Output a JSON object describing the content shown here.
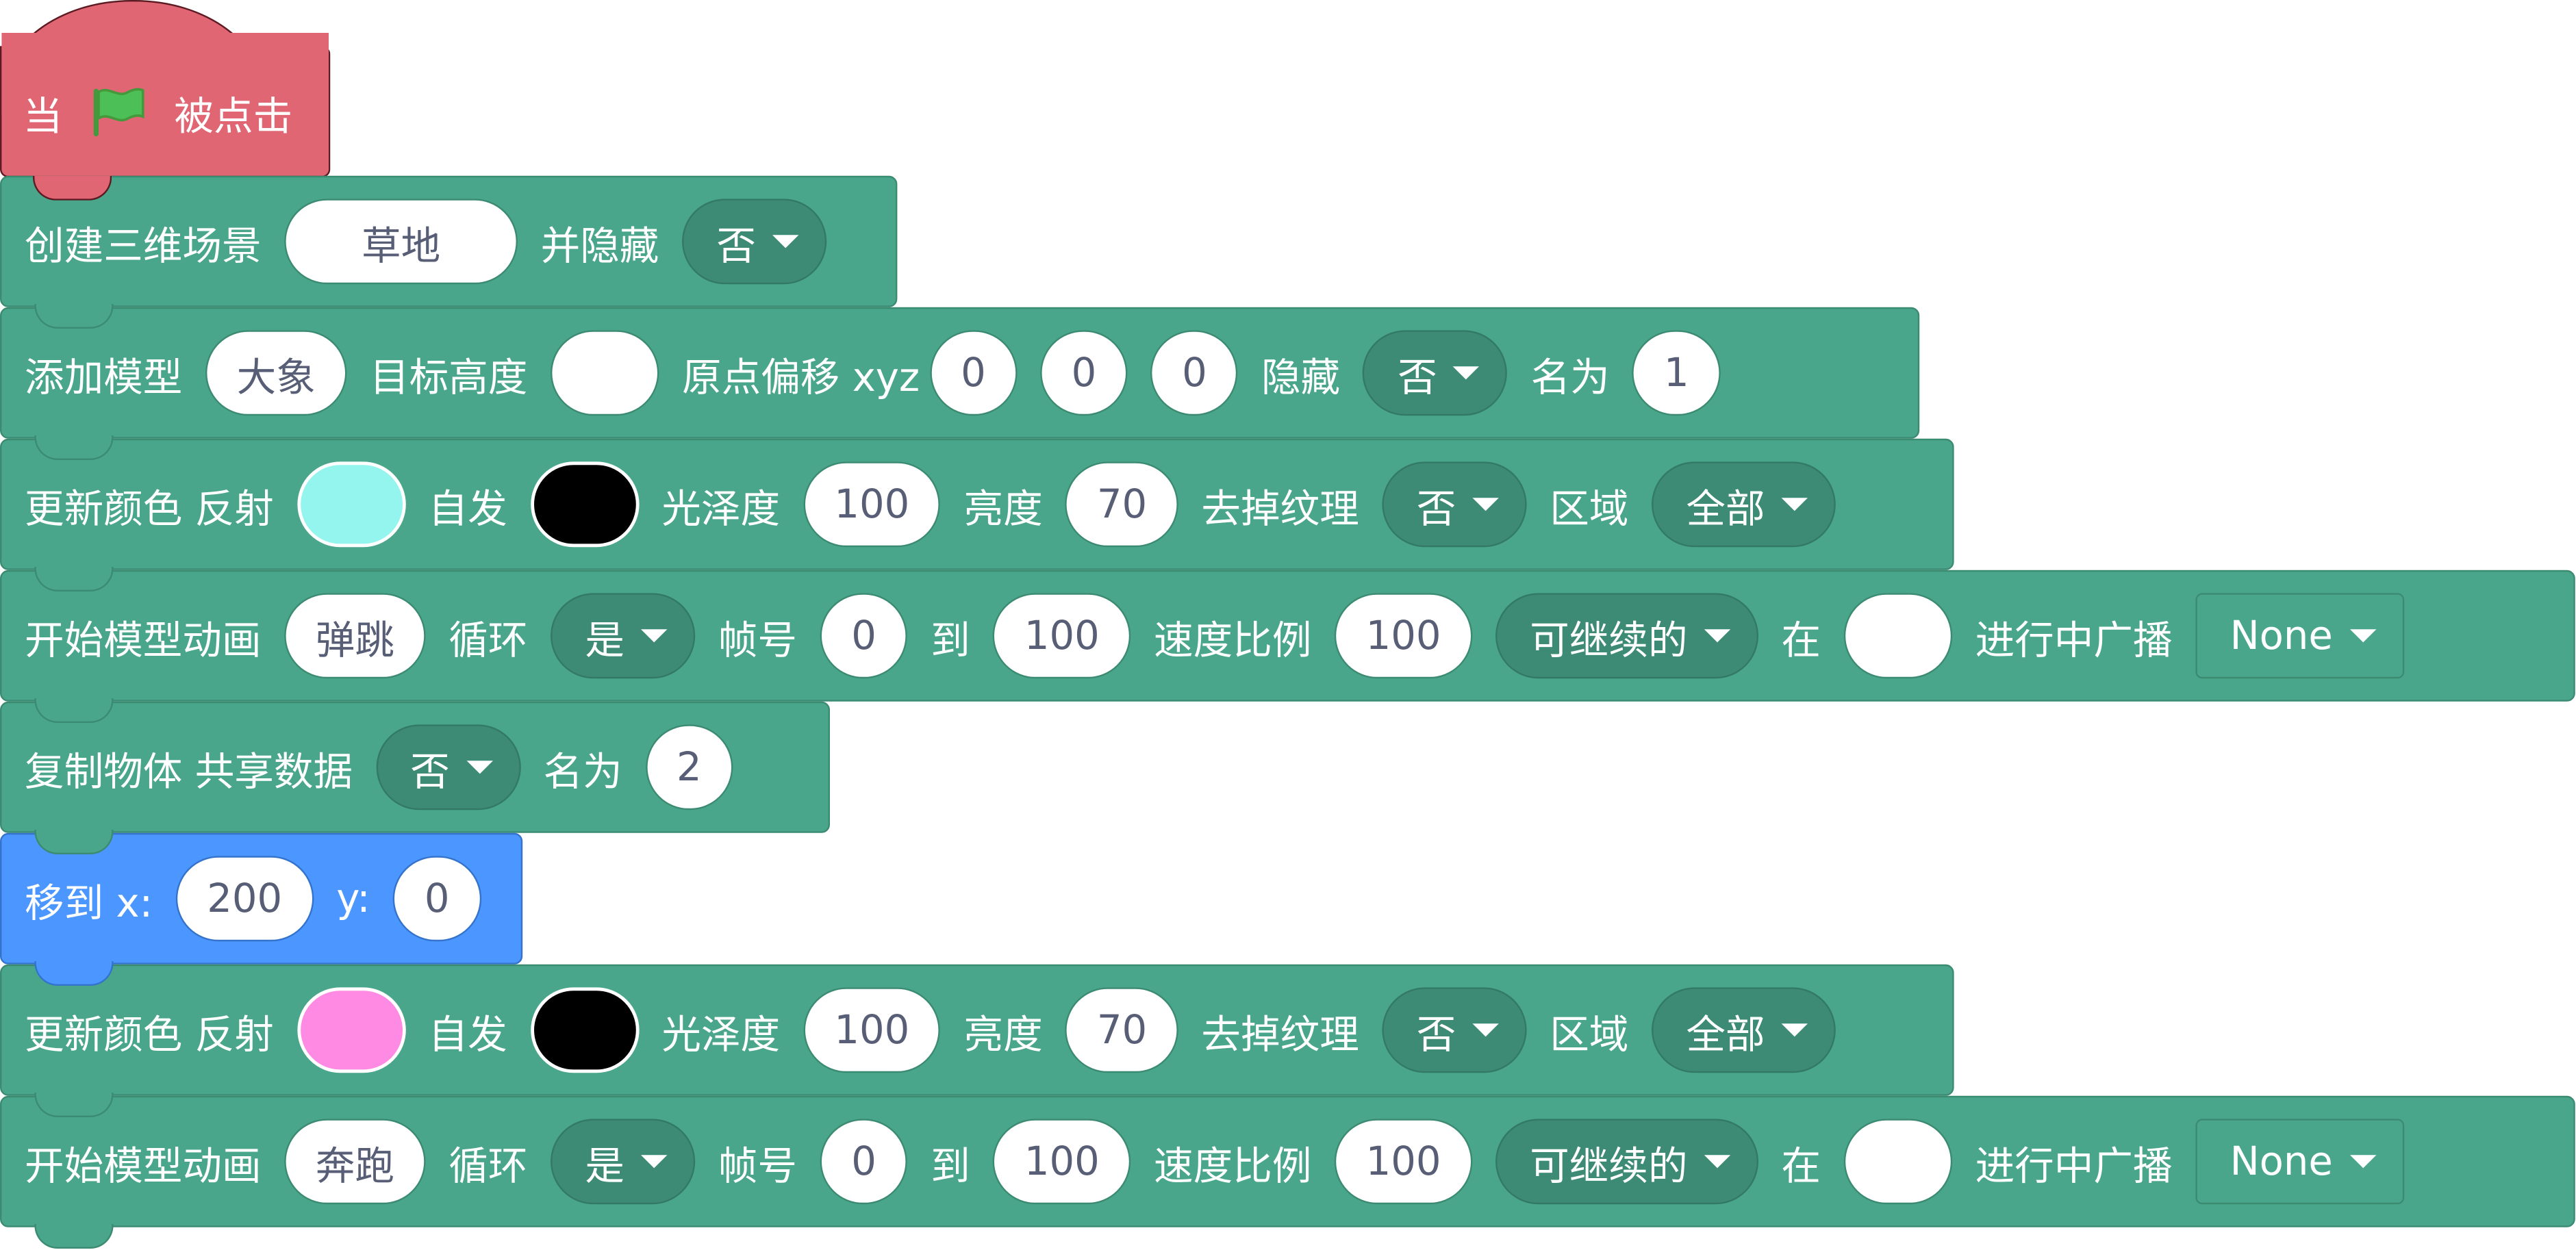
{
  "colors": {
    "motion": "#4c97ff",
    "extension": "#4aa68b",
    "events": "#e06673",
    "color_cyan": "#93f5ed",
    "color_black": "#000000",
    "color_pink": "#ff8ae4"
  },
  "hat": {
    "prefix": "当",
    "icon": "green-flag-icon",
    "suffix": "被点击"
  },
  "b1": {
    "label": "创建三维场景",
    "scene": "草地",
    "hide_label": "并隐藏",
    "hide": "否"
  },
  "b2": {
    "label": "添加模型",
    "model": "大象",
    "height_label": "目标高度",
    "height": "",
    "offset_label": "原点偏移 xyz",
    "x": "0",
    "y": "0",
    "z": "0",
    "hide_label": "隐藏",
    "hide": "否",
    "name_label": "名为",
    "name": "1"
  },
  "b3": {
    "label": "更新颜色 反射",
    "emit_label": "自发",
    "gloss_label": "光泽度",
    "gloss": "100",
    "bright_label": "亮度",
    "bright": "70",
    "texture_label": "去掉纹理",
    "texture": "否",
    "area_label": "区域",
    "area": "全部"
  },
  "b4": {
    "label": "开始模型动画",
    "anim": "弹跳",
    "loop_label": "循环",
    "loop": "是",
    "frame_label": "帧号",
    "from": "0",
    "to_label": "到",
    "to": "100",
    "speed_label": "速度比例",
    "speed": "100",
    "mode": "可继续的",
    "at_label": "在",
    "at": "",
    "broadcast_label": "进行中广播",
    "broadcast": "None"
  },
  "b5": {
    "label": "复制物体 共享数据",
    "share": "否",
    "name_label": "名为",
    "name": "2"
  },
  "b6": {
    "label": "移到 x:",
    "x": "200",
    "y_label": "y:",
    "y": "0"
  },
  "b7": {
    "label": "更新颜色 反射",
    "emit_label": "自发",
    "gloss_label": "光泽度",
    "gloss": "100",
    "bright_label": "亮度",
    "bright": "70",
    "texture_label": "去掉纹理",
    "texture": "否",
    "area_label": "区域",
    "area": "全部"
  },
  "b8": {
    "label": "开始模型动画",
    "anim": "奔跑",
    "loop_label": "循环",
    "loop": "是",
    "frame_label": "帧号",
    "from": "0",
    "to_label": "到",
    "to": "100",
    "speed_label": "速度比例",
    "speed": "100",
    "mode": "可继续的",
    "at_label": "在",
    "at": "",
    "broadcast_label": "进行中广播",
    "broadcast": "None"
  }
}
